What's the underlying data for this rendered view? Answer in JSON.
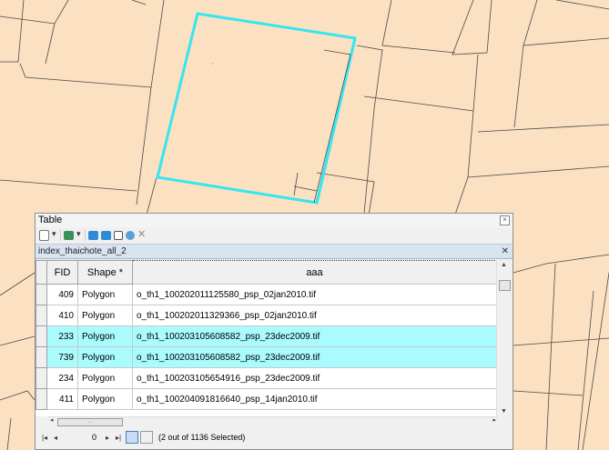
{
  "table_window": {
    "title": "Table",
    "layer_tab": "index_thaichote_all_2",
    "columns": [
      "FID",
      "Shape *",
      "aaa"
    ],
    "rows": [
      {
        "fid": "409",
        "shape": "Polygon",
        "aaa": "o_th1_100202011125580_psp_02jan2010.tif",
        "selected": false
      },
      {
        "fid": "410",
        "shape": "Polygon",
        "aaa": "o_th1_100202011329366_psp_02jan2010.tif",
        "selected": false
      },
      {
        "fid": "233",
        "shape": "Polygon",
        "aaa": "o_th1_100203105608582_psp_23dec2009.tif",
        "selected": true
      },
      {
        "fid": "739",
        "shape": "Polygon",
        "aaa": "o_th1_100203105608582_psp_23dec2009.tif",
        "selected": true
      },
      {
        "fid": "234",
        "shape": "Polygon",
        "aaa": "o_th1_100203105654916_psp_23dec2009.tif",
        "selected": false
      },
      {
        "fid": "411",
        "shape": "Polygon",
        "aaa": "o_th1_100204091816640_psp_14jan2010.tif",
        "selected": false
      }
    ],
    "record_number": "0",
    "status_text": "(2 out of 1136 Selected)",
    "hscroll_grip": "…"
  },
  "colors": {
    "map_fill": "#fbe0c2",
    "selection_outline": "#36e6ef",
    "selected_row": "#a9fbfd"
  },
  "icons": [
    "table-options-icon",
    "related-tables-icon",
    "select-by-attributes-icon",
    "switch-selection-icon",
    "clear-selection-icon",
    "zoom-to-selected-icon",
    "delete-selected-icon",
    "close-icon",
    "first-record-icon",
    "previous-record-icon",
    "next-record-icon",
    "last-record-icon",
    "show-all-records-icon",
    "show-selected-records-icon"
  ]
}
